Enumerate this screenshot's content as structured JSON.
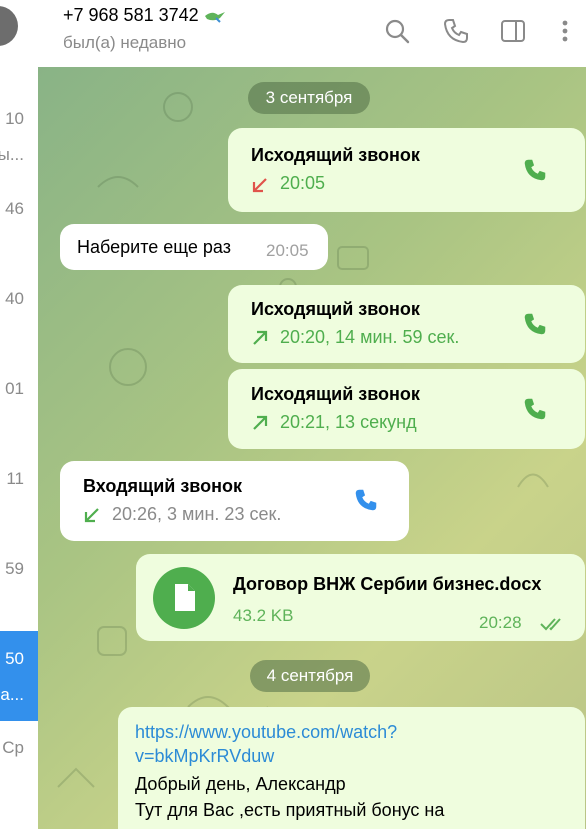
{
  "sidebar": {
    "rows": [
      {
        "time": "10",
        "snippet": "ы..."
      },
      {
        "time": "46",
        "snippet": ""
      },
      {
        "time": "40",
        "snippet": ""
      },
      {
        "time": "01",
        "snippet": ""
      },
      {
        "time": "11",
        "snippet": ""
      },
      {
        "time": "59",
        "snippet": ""
      },
      {
        "time": "50",
        "snippet": "а..."
      },
      {
        "time": "",
        "snippet": "Ср"
      }
    ]
  },
  "header": {
    "title": "+7 968 581 3742",
    "status": "был(а) недавно"
  },
  "chat": {
    "dates": [
      "3 сентября",
      "4 сентября"
    ],
    "calls": [
      {
        "title": "Исходящий звонок",
        "meta": "20:05",
        "direction": "outgoing-missed"
      },
      {
        "title": "Исходящий звонок",
        "meta": "20:20, 14 мин. 59 сек.",
        "direction": "outgoing"
      },
      {
        "title": "Исходящий звонок",
        "meta": "20:21, 13 секунд",
        "direction": "outgoing"
      },
      {
        "title": "Входящий звонок",
        "meta": "20:26, 3 мин. 23 сек.",
        "direction": "incoming"
      }
    ],
    "incoming_message": {
      "text": "Наберите еще раз",
      "time": "20:05"
    },
    "file": {
      "name": "Договор ВНЖ Сербии бизнес.docx",
      "size": "43.2 KB",
      "time": "20:28"
    },
    "last_message": {
      "link": "https://www.youtube.com/watch?v=bkMpKrRVduw",
      "link_line1": "https://www.youtube.com/watch?",
      "link_line2": "v=bkMpKrRVduw",
      "line1": "Добрый день, Александр",
      "line2": "Тут для Вас  ,есть приятный бонус на"
    }
  },
  "colors": {
    "accent": "#3390ec",
    "green": "#4fae4e",
    "outgoing_bubble": "#effdde",
    "missed": "#e0544b"
  }
}
